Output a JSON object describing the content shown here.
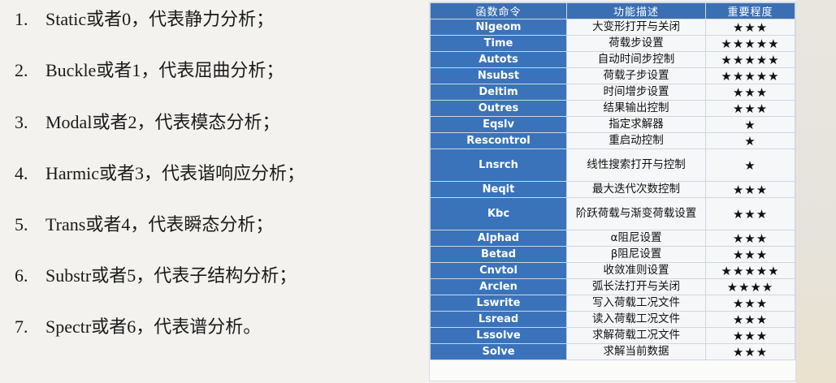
{
  "list": [
    {
      "num": "1.",
      "text": "Static或者0，代表静力分析；"
    },
    {
      "num": "2.",
      "text": "Buckle或者1，代表屈曲分析；"
    },
    {
      "num": "3.",
      "text": "Modal或者2，代表模态分析；"
    },
    {
      "num": "4.",
      "text": "Harmic或者3，代表谐响应分析；"
    },
    {
      "num": "5.",
      "text": "Trans或者4，代表瞬态分析；"
    },
    {
      "num": "6.",
      "text": "Substr或者5，代表子结构分析；"
    },
    {
      "num": "7.",
      "text": "Spectr或者6，代表谱分析。"
    }
  ],
  "table": {
    "headers": [
      "函数命令",
      "功能描述",
      "重要程度"
    ],
    "rows": [
      {
        "cmd": "Nlgeom",
        "desc": "大变形打开与关闭",
        "rating": "★★★"
      },
      {
        "cmd": "Time",
        "desc": "荷载步设置",
        "rating": "★★★★★"
      },
      {
        "cmd": "Autots",
        "desc": "自动时间步控制",
        "rating": "★★★★★"
      },
      {
        "cmd": "Nsubst",
        "desc": "荷载子步设置",
        "rating": "★★★★★"
      },
      {
        "cmd": "Deltim",
        "desc": "时间增步设置",
        "rating": "★★★"
      },
      {
        "cmd": "Outres",
        "desc": "结果输出控制",
        "rating": "★★★"
      },
      {
        "cmd": "Eqslv",
        "desc": "指定求解器",
        "rating": "★"
      },
      {
        "cmd": "Rescontrol",
        "desc": "重启动控制",
        "rating": "★"
      },
      {
        "cmd": "Lnsrch",
        "desc": "线性搜索打开与控制",
        "rating": "★"
      },
      {
        "cmd": "Neqit",
        "desc": "最大迭代次数控制",
        "rating": "★★★"
      },
      {
        "cmd": "Kbc",
        "desc": "阶跃荷载与渐变荷载设置",
        "rating": "★★★"
      },
      {
        "cmd": "Alphad",
        "desc": "α阻尼设置",
        "rating": "★★★"
      },
      {
        "cmd": "Betad",
        "desc": "β阻尼设置",
        "rating": "★★★"
      },
      {
        "cmd": "Cnvtol",
        "desc": "收敛准则设置",
        "rating": "★★★★★"
      },
      {
        "cmd": "Arclen",
        "desc": "弧长法打开与关闭",
        "rating": "★★★★"
      },
      {
        "cmd": "Lswrite",
        "desc": "写入荷载工况文件",
        "rating": "★★★"
      },
      {
        "cmd": "Lsread",
        "desc": "读入荷载工况文件",
        "rating": "★★★"
      },
      {
        "cmd": "Lssolve",
        "desc": "求解荷载工况文件",
        "rating": "★★★"
      },
      {
        "cmd": "Solve",
        "desc": "求解当前数据",
        "rating": "★★★"
      }
    ]
  }
}
